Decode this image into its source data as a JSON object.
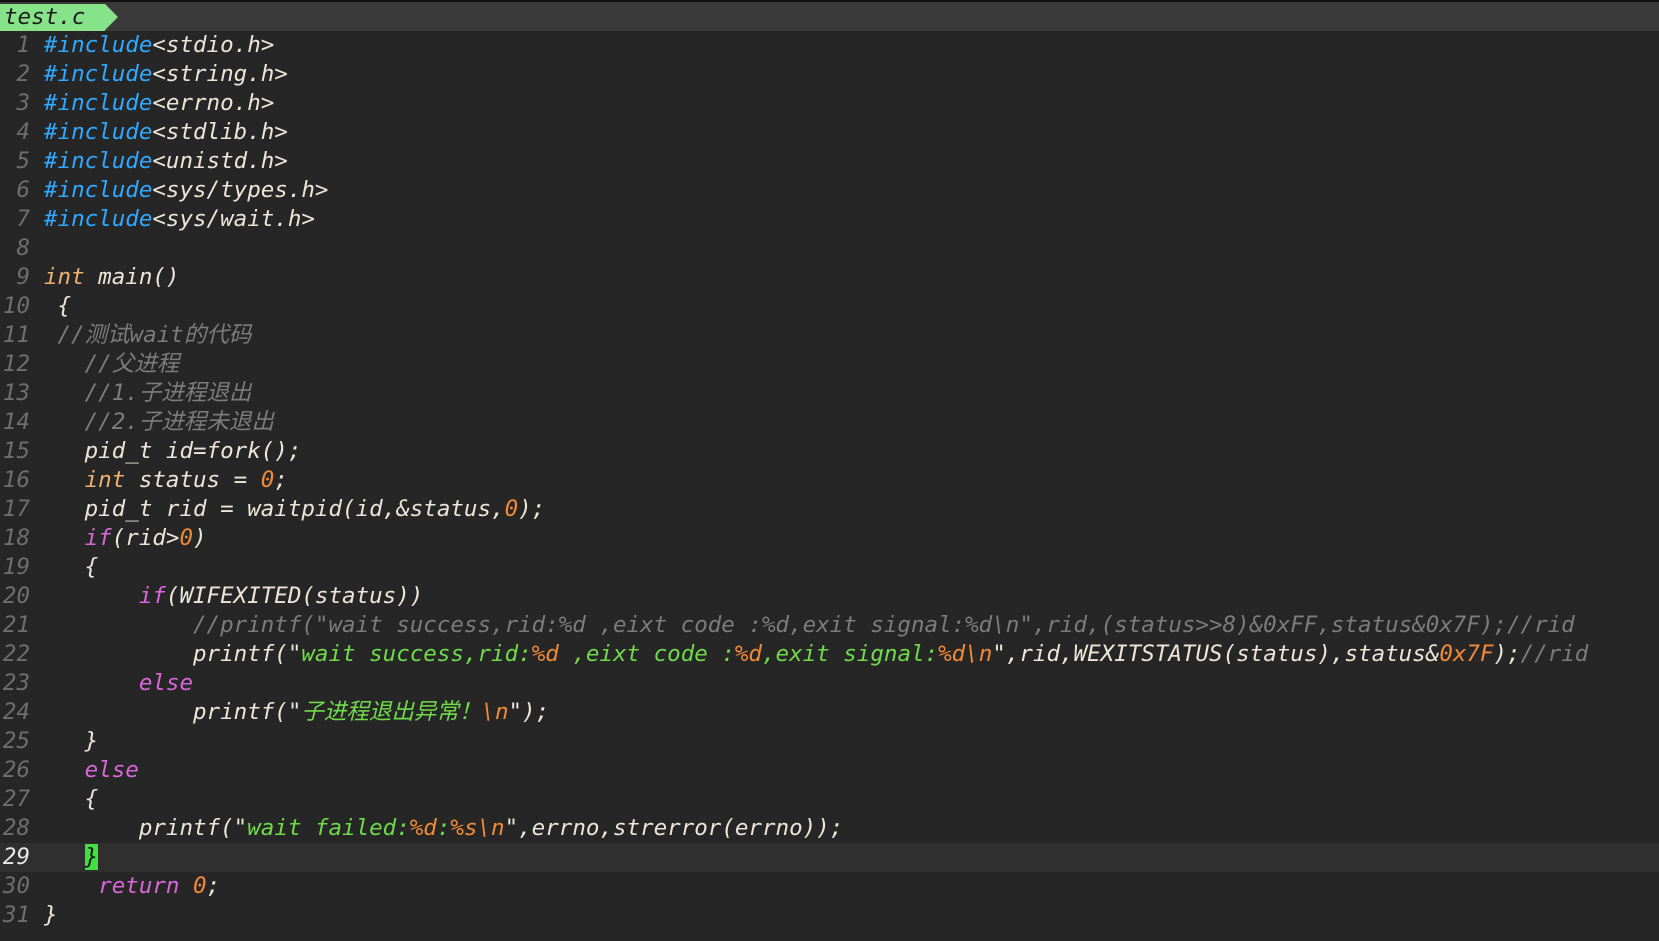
{
  "tab": {
    "filename": "test.c"
  },
  "colors": {
    "background": "#262626",
    "preprocessor": "#2fa9ff",
    "type": "#f0b070",
    "keyword": "#d967d9",
    "number": "#f08a36",
    "string": "#6fdb4a",
    "comment": "#7c7c7c",
    "cursor": "#3fe03f",
    "tab": "#87e38a"
  },
  "editor": {
    "cursor_line": 29,
    "lines": [
      {
        "n": "1",
        "tokens": [
          {
            "t": "pre",
            "v": "#include"
          },
          {
            "t": "inc",
            "v": "<stdio.h>"
          }
        ]
      },
      {
        "n": "2",
        "tokens": [
          {
            "t": "pre",
            "v": "#include"
          },
          {
            "t": "inc",
            "v": "<string.h>"
          }
        ]
      },
      {
        "n": "3",
        "tokens": [
          {
            "t": "pre",
            "v": "#include"
          },
          {
            "t": "inc",
            "v": "<errno.h>"
          }
        ]
      },
      {
        "n": "4",
        "tokens": [
          {
            "t": "pre",
            "v": "#include"
          },
          {
            "t": "inc",
            "v": "<stdlib.h>"
          }
        ]
      },
      {
        "n": "5",
        "tokens": [
          {
            "t": "pre",
            "v": "#include"
          },
          {
            "t": "inc",
            "v": "<unistd.h>"
          }
        ]
      },
      {
        "n": "6",
        "tokens": [
          {
            "t": "pre",
            "v": "#include"
          },
          {
            "t": "inc",
            "v": "<sys/types.h>"
          }
        ]
      },
      {
        "n": "7",
        "tokens": [
          {
            "t": "pre",
            "v": "#include"
          },
          {
            "t": "inc",
            "v": "<sys/wait.h>"
          }
        ]
      },
      {
        "n": "8",
        "tokens": []
      },
      {
        "n": "9",
        "tokens": [
          {
            "t": "type",
            "v": "int"
          },
          {
            "t": "plain",
            "v": " main()"
          }
        ]
      },
      {
        "n": "10",
        "tokens": [
          {
            "t": "plain",
            "v": " {"
          }
        ]
      },
      {
        "n": "11",
        "tokens": [
          {
            "t": "cmt",
            "v": " //测试wait的代码"
          }
        ]
      },
      {
        "n": "12",
        "tokens": [
          {
            "t": "cmt",
            "v": "   //父进程"
          }
        ]
      },
      {
        "n": "13",
        "tokens": [
          {
            "t": "cmt",
            "v": "   //1.子进程退出"
          }
        ]
      },
      {
        "n": "14",
        "tokens": [
          {
            "t": "cmt",
            "v": "   //2.子进程未退出"
          }
        ]
      },
      {
        "n": "15",
        "tokens": [
          {
            "t": "plain",
            "v": "   pid_t id=fork();"
          }
        ]
      },
      {
        "n": "16",
        "tokens": [
          {
            "t": "plain",
            "v": "   "
          },
          {
            "t": "type",
            "v": "int"
          },
          {
            "t": "plain",
            "v": " status = "
          },
          {
            "t": "num",
            "v": "0"
          },
          {
            "t": "plain",
            "v": ";"
          }
        ]
      },
      {
        "n": "17",
        "tokens": [
          {
            "t": "plain",
            "v": "   pid_t rid = waitpid(id,&status,"
          },
          {
            "t": "num",
            "v": "0"
          },
          {
            "t": "plain",
            "v": ");"
          }
        ]
      },
      {
        "n": "18",
        "tokens": [
          {
            "t": "plain",
            "v": "   "
          },
          {
            "t": "kw",
            "v": "if"
          },
          {
            "t": "plain",
            "v": "(rid>"
          },
          {
            "t": "num",
            "v": "0"
          },
          {
            "t": "plain",
            "v": ")"
          }
        ]
      },
      {
        "n": "19",
        "tokens": [
          {
            "t": "plain",
            "v": "   {"
          }
        ]
      },
      {
        "n": "20",
        "tokens": [
          {
            "t": "plain",
            "v": "       "
          },
          {
            "t": "kw",
            "v": "if"
          },
          {
            "t": "plain",
            "v": "(WIFEXITED(status))"
          }
        ]
      },
      {
        "n": "21",
        "tokens": [
          {
            "t": "cmt",
            "v": "           //printf(\"wait success,rid:%d ,eixt code :%d,exit signal:%d\\n\",rid,(status>>8)&0xFF,status&0x7F);//rid"
          }
        ]
      },
      {
        "n": "22",
        "tokens": [
          {
            "t": "plain",
            "v": "           printf(\""
          },
          {
            "t": "str",
            "v": "wait success,rid:"
          },
          {
            "t": "fmt",
            "v": "%d"
          },
          {
            "t": "str",
            "v": " ,eixt code :"
          },
          {
            "t": "fmt",
            "v": "%d"
          },
          {
            "t": "str",
            "v": ",exit signal:"
          },
          {
            "t": "fmt",
            "v": "%d\\n"
          },
          {
            "t": "plain",
            "v": "\",rid,WEXITSTATUS(status),status&"
          },
          {
            "t": "num",
            "v": "0x7F"
          },
          {
            "t": "plain",
            "v": ");"
          },
          {
            "t": "cmt",
            "v": "//rid"
          }
        ]
      },
      {
        "n": "23",
        "tokens": [
          {
            "t": "plain",
            "v": "       "
          },
          {
            "t": "kw",
            "v": "else"
          }
        ]
      },
      {
        "n": "24",
        "tokens": [
          {
            "t": "plain",
            "v": "           printf(\""
          },
          {
            "t": "str",
            "v": "子进程退出异常！"
          },
          {
            "t": "fmt",
            "v": "\\n"
          },
          {
            "t": "plain",
            "v": "\");"
          }
        ]
      },
      {
        "n": "25",
        "tokens": [
          {
            "t": "plain",
            "v": "   }"
          }
        ]
      },
      {
        "n": "26",
        "tokens": [
          {
            "t": "plain",
            "v": "   "
          },
          {
            "t": "kw",
            "v": "else"
          }
        ]
      },
      {
        "n": "27",
        "tokens": [
          {
            "t": "plain",
            "v": "   {"
          }
        ]
      },
      {
        "n": "28",
        "tokens": [
          {
            "t": "plain",
            "v": "       printf(\""
          },
          {
            "t": "str",
            "v": "wait failed:"
          },
          {
            "t": "fmt",
            "v": "%d"
          },
          {
            "t": "str",
            "v": ":"
          },
          {
            "t": "fmt",
            "v": "%s\\n"
          },
          {
            "t": "plain",
            "v": "\",errno,strerror(errno));"
          }
        ]
      },
      {
        "n": "29",
        "tokens": [
          {
            "t": "plain",
            "v": "   "
          },
          {
            "t": "cursor",
            "v": "}"
          }
        ]
      },
      {
        "n": "30",
        "tokens": [
          {
            "t": "plain",
            "v": "    "
          },
          {
            "t": "kw",
            "v": "return"
          },
          {
            "t": "plain",
            "v": " "
          },
          {
            "t": "num",
            "v": "0"
          },
          {
            "t": "plain",
            "v": ";"
          }
        ]
      },
      {
        "n": "31",
        "tokens": [
          {
            "t": "plain",
            "v": "}"
          }
        ]
      }
    ]
  }
}
